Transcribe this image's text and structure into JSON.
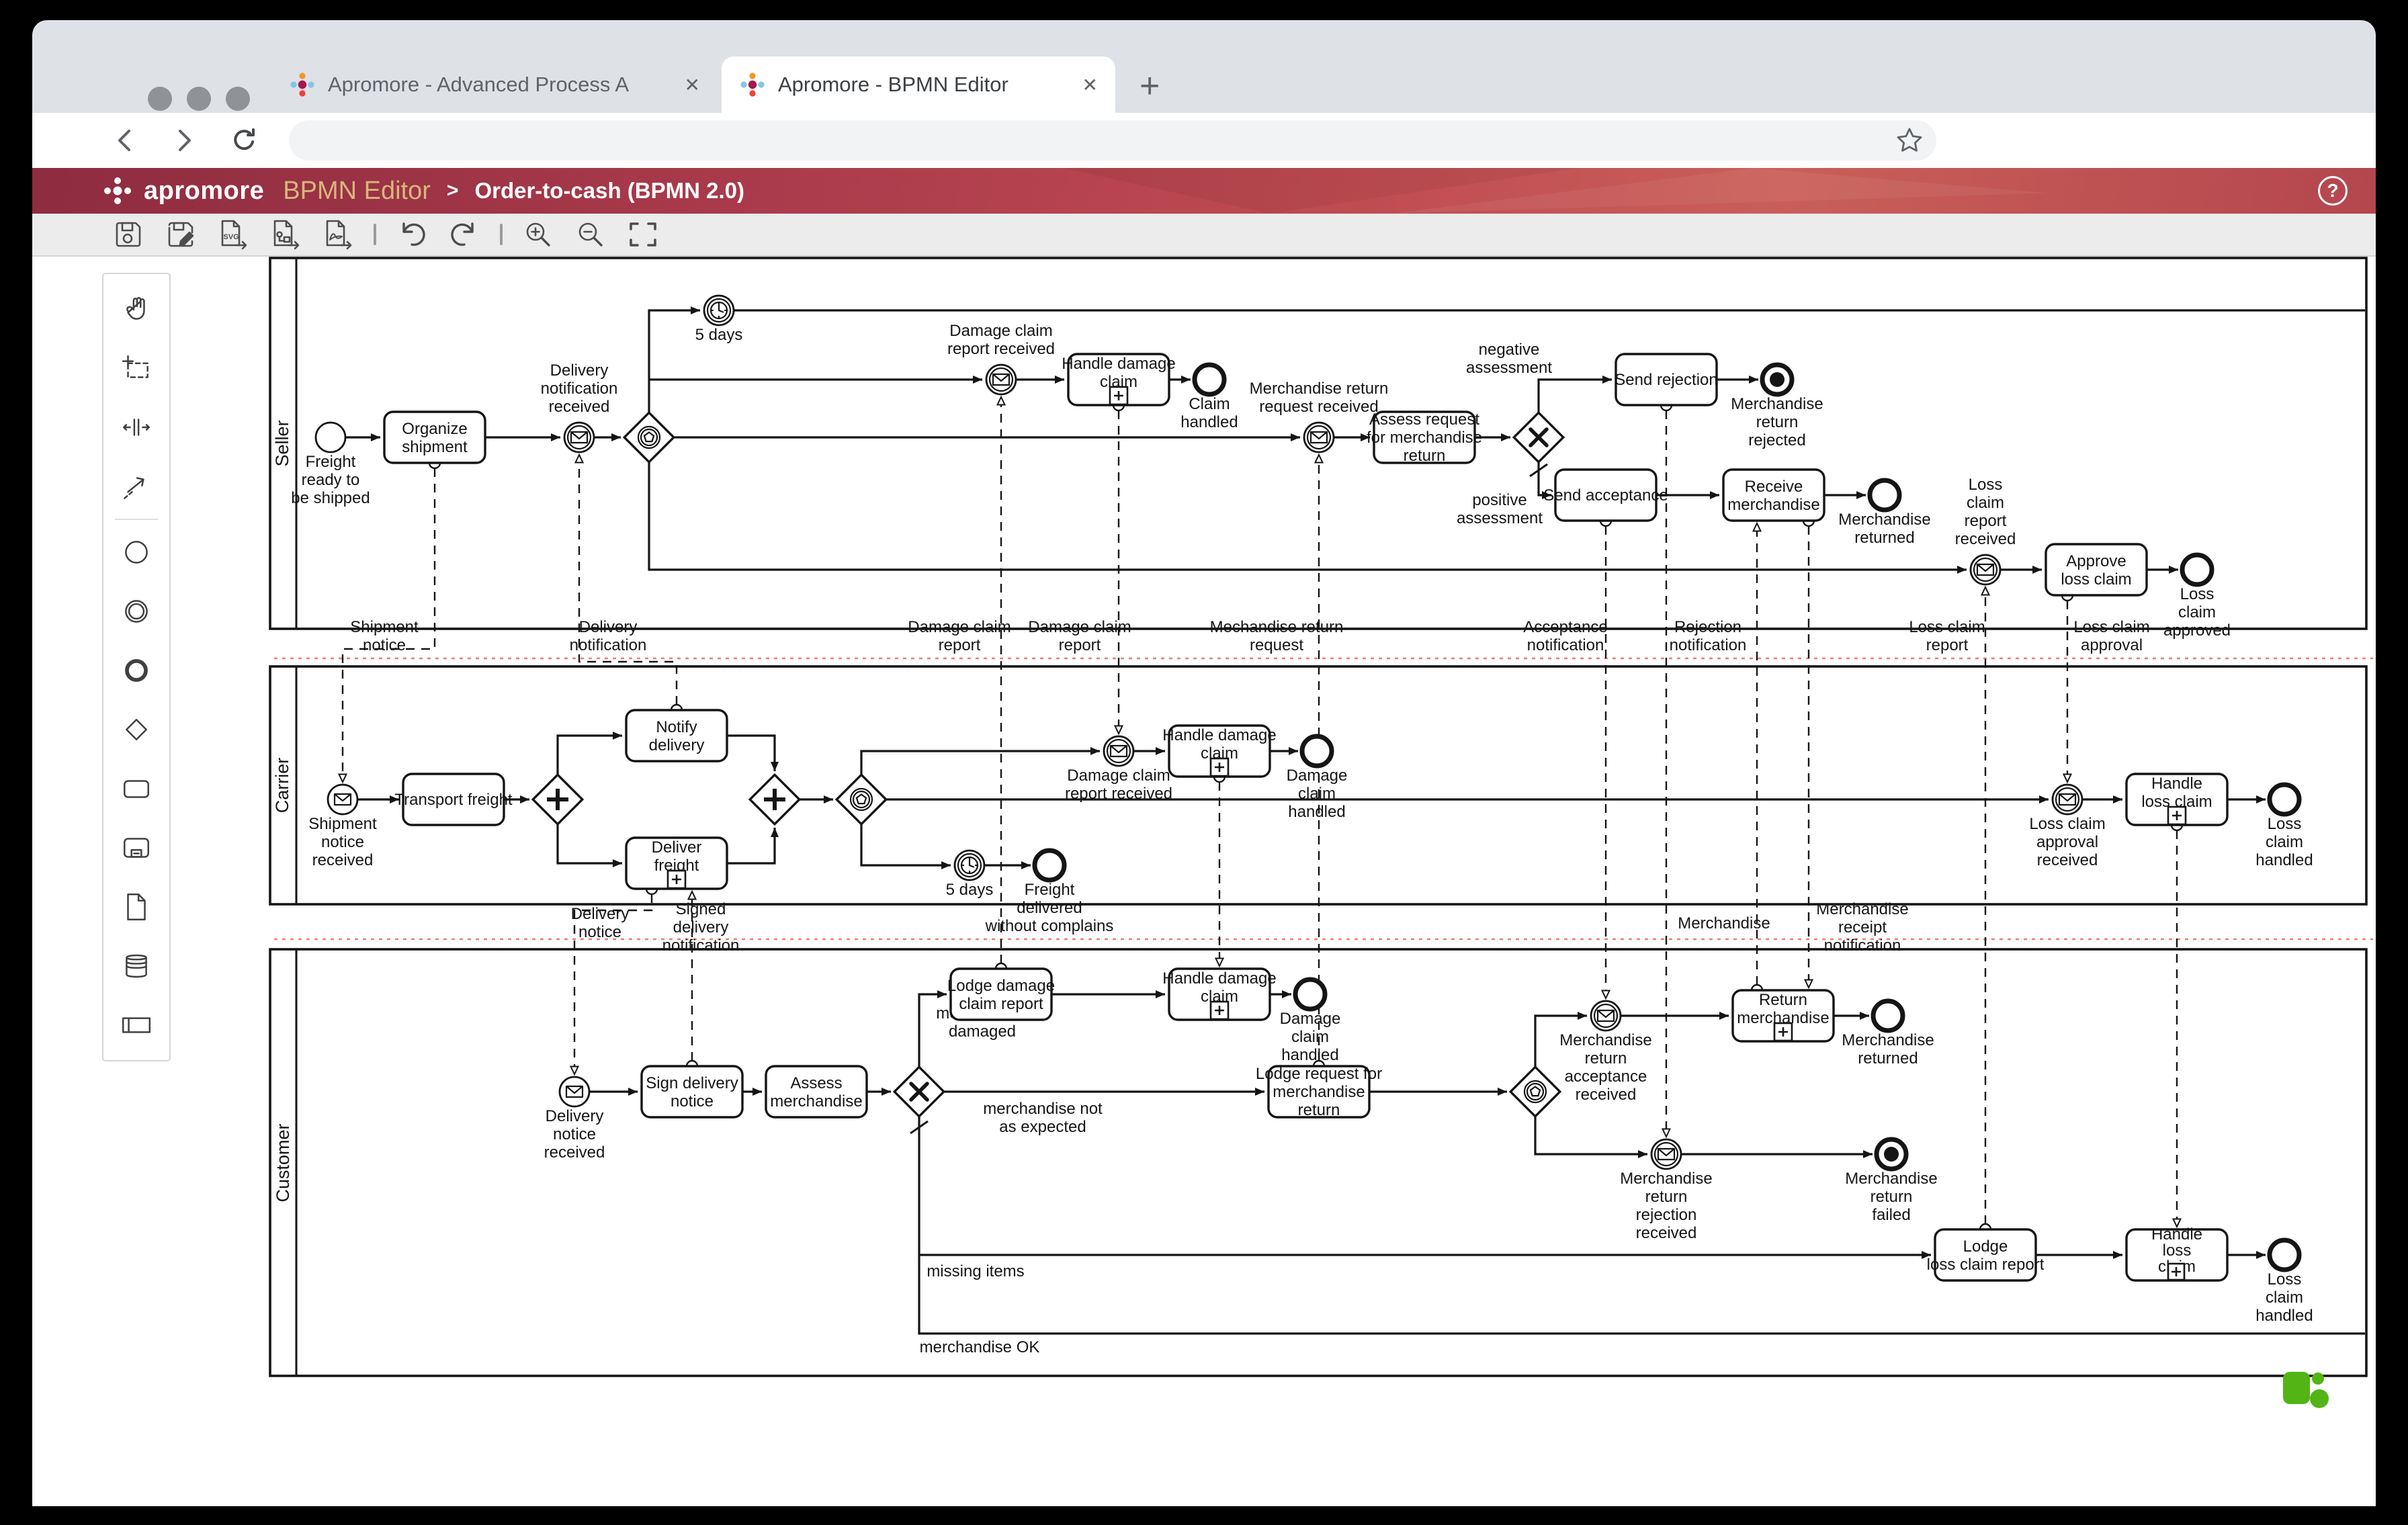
{
  "browser": {
    "tab1_title": "Apromore - Advanced Process A",
    "tab2_title": "Apromore - BPMN Editor",
    "close_glyph": "✕",
    "new_tab_glyph": "+"
  },
  "header": {
    "brand": "apromore",
    "app_title": "BPMN Editor",
    "separator": ">",
    "model_name": "Order-to-cash (BPMN 2.0)",
    "help_glyph": "?"
  },
  "toolbar": {
    "svg_badge": "SVG"
  },
  "colors": {
    "header_left": "#8e2c40",
    "header_mid": "#bf4a52",
    "header_right": "#b4464e",
    "guide_red": "#f07b72",
    "logo_green": "#52b415",
    "brand_gold": "#d9b67c"
  },
  "lanes": {
    "seller": "Seller",
    "carrier": "Carrier",
    "customer": "Customer"
  },
  "seller": {
    "start_freight": [
      "Freight",
      "ready to",
      "be shipped"
    ],
    "organize_shipment": [
      "Organize",
      "shipment"
    ],
    "delivery_notification_received": [
      "Delivery",
      "notification",
      "received"
    ],
    "timer_5days": [
      "5 days"
    ],
    "damage_claim_report_received": [
      "Damage claim",
      "report received"
    ],
    "handle_damage_claim": [
      "Handle damage",
      "claim"
    ],
    "claim_handled": [
      "Claim",
      "handled"
    ],
    "merch_return_request_received": [
      "Merchandise return",
      "request received"
    ],
    "assess_request": [
      "Assess request",
      "for merchandise",
      "return"
    ],
    "negative_assessment": [
      "negative",
      "assessment"
    ],
    "positive_assessment": [
      "positive",
      "assessment"
    ],
    "send_rejection": [
      "Send rejection"
    ],
    "merch_return_rejected": [
      "Merchandise",
      "return",
      "rejected"
    ],
    "send_acceptance": [
      "Send acceptance"
    ],
    "receive_merchandise": [
      "Receive",
      "merchandise"
    ],
    "merchandise_returned": [
      "Merchandise",
      "returned"
    ],
    "loss_claim_report_received": [
      "Loss",
      "claim",
      "report",
      "received"
    ],
    "approve_loss_claim": [
      "Approve",
      "loss claim"
    ],
    "loss_claim_approved": [
      "Loss",
      "claim",
      "approved"
    ]
  },
  "carrier": {
    "shipment_notice_received": [
      "Shipment",
      "notice",
      "received"
    ],
    "transport_freight": [
      "Transport freight"
    ],
    "notify_delivery": [
      "Notify",
      "delivery"
    ],
    "deliver_freight": [
      "Deliver",
      "freight"
    ],
    "timer_5days": [
      "5 days"
    ],
    "freight_delivered": [
      "Freight",
      "delivered",
      "without complains"
    ],
    "damage_claim_report_received": [
      "Damage claim",
      "report received"
    ],
    "handle_damage_claim": [
      "Handle damage",
      "claim"
    ],
    "damage_claim_handled": [
      "Damage",
      "claim",
      "handled"
    ],
    "loss_claim_approval_received": [
      "Loss claim",
      "approval",
      "received"
    ],
    "handle_loss_claim": [
      "Handle",
      "loss claim"
    ],
    "loss_claim_handled": [
      "Loss",
      "claim",
      "handled"
    ]
  },
  "customer": {
    "delivery_notice_received": [
      "Delivery",
      "notice",
      "received"
    ],
    "sign_delivery_notice": [
      "Sign delivery",
      "notice"
    ],
    "assess_merchandise": [
      "Assess",
      "merchandise"
    ],
    "merchandise_damaged": [
      "merchandise",
      "damaged"
    ],
    "merchandise_not_as_expected": [
      "merchandise not",
      "as expected"
    ],
    "missing_items": [
      "missing items"
    ],
    "merchandise_ok": [
      "merchandise OK"
    ],
    "lodge_damage_claim_report": [
      "Lodge damage",
      "claim report"
    ],
    "handle_damage_claim": [
      "Handle damage",
      "claim"
    ],
    "damage_claim_handled": [
      "Damage",
      "claim",
      "handled"
    ],
    "lodge_request_return": [
      "Lodge request for",
      "merchandise",
      "return"
    ],
    "merch_return_acceptance_received": [
      "Merchandise",
      "return",
      "acceptance",
      "received"
    ],
    "return_merchandise": [
      "Return",
      "merchandise"
    ],
    "merchandise_returned": [
      "Merchandise",
      "returned"
    ],
    "merch_return_rejection_received": [
      "Merchandise",
      "return",
      "rejection",
      "received"
    ],
    "merch_return_failed": [
      "Merchandise",
      "return",
      "failed"
    ],
    "lodge_loss_claim_report": [
      "Lodge",
      "loss claim report"
    ],
    "handle_loss_claim": [
      "Handle",
      "loss",
      "claim"
    ],
    "loss_claim_handled": [
      "Loss",
      "claim",
      "handled"
    ]
  },
  "messages": {
    "shipment_notice": [
      "Shipment",
      "notice"
    ],
    "delivery_notification": [
      "Delivery",
      "notification"
    ],
    "damage_claim_report_a": [
      "Damage claim",
      "report"
    ],
    "damage_claim_report_b": [
      "Damage claim",
      "report"
    ],
    "mechandise_return_request": [
      "Mechandise return",
      "request"
    ],
    "acceptance_notification": [
      "Acceptance",
      "notification"
    ],
    "rejection_notification": [
      "Rejection",
      "notification"
    ],
    "loss_claim_report": [
      "Loss claim",
      "report"
    ],
    "loss_claim_approval": [
      "Loss claim",
      "approval"
    ],
    "delivery_notice": [
      "Delivery",
      "notice"
    ],
    "signed_delivery_notification": [
      "Signed",
      "delivery",
      "notification"
    ],
    "merchandise": [
      "Merchandise"
    ],
    "merchandise_receipt_notification": [
      "Merchandise",
      "receipt",
      "notification"
    ]
  }
}
